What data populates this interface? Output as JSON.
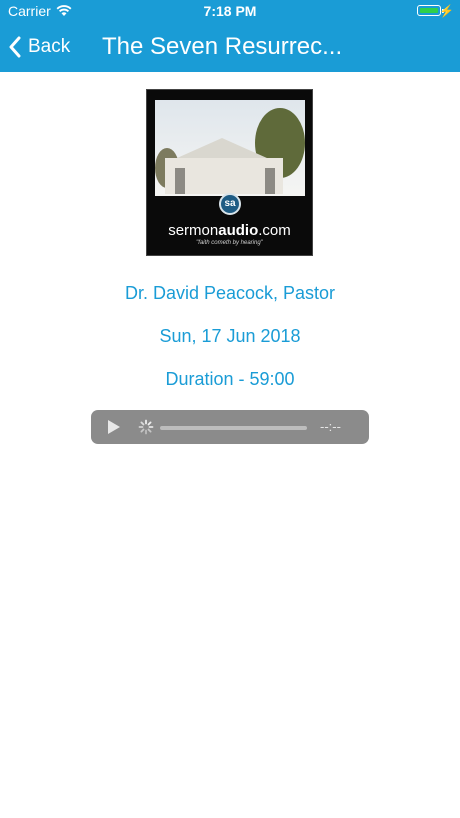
{
  "status_bar": {
    "carrier": "Carrier",
    "time": "7:18 PM",
    "battery_color": "#2fd04a"
  },
  "nav": {
    "back_label": "Back",
    "title": "The Seven Resurrec...",
    "bar_color": "#1a9cd6"
  },
  "artwork": {
    "logo_text": "sa",
    "brand_plain": "sermon",
    "brand_bold": "audio",
    "brand_suffix": ".com",
    "tagline": "\"faith cometh by hearing\""
  },
  "sermon": {
    "speaker": "Dr. David Peacock, Pastor",
    "date": "Sun, 17 Jun 2018",
    "duration": "Duration - 59:00"
  },
  "player": {
    "time": "--:--",
    "play_icon": "play-icon",
    "loading_icon": "loading-spinner-icon"
  }
}
